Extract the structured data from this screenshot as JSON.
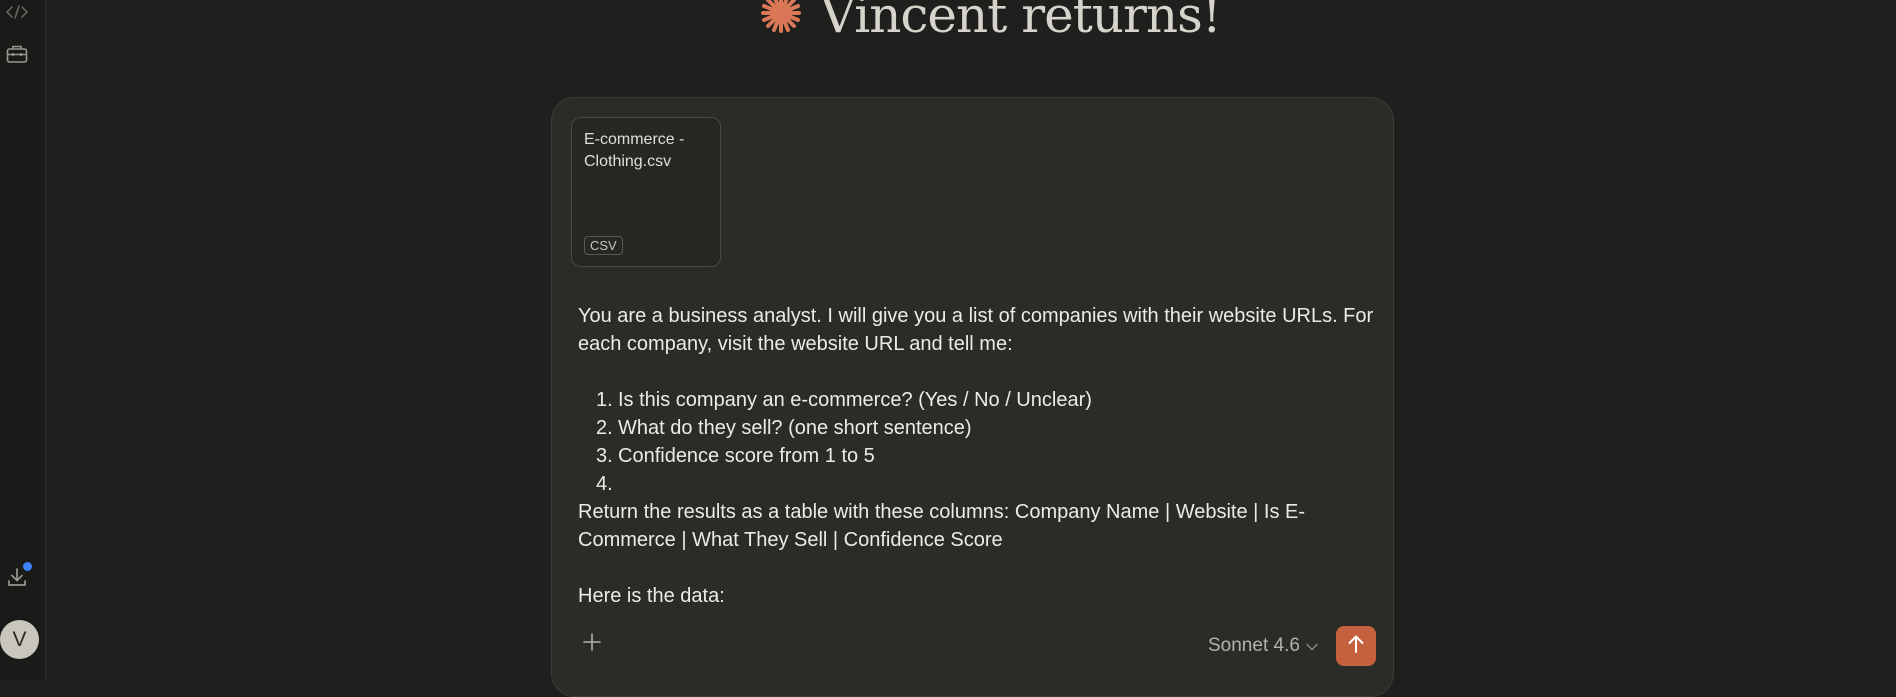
{
  "sidebar": {
    "icons": [
      "code-icon",
      "toolbox-icon",
      "download-icon"
    ],
    "avatar_initial": "V"
  },
  "greeting": {
    "text": "Vincent returns!",
    "accent_color": "#d97757"
  },
  "composer": {
    "attachment": {
      "filename": "E-commerce - Clothing.csv",
      "type_badge": "CSV"
    },
    "prompt": {
      "intro": "You are a business analyst. I will give you a list of companies with their website URLs. For each company, visit the website URL and tell me:",
      "items": [
        {
          "num": "1.",
          "text": "Is this company an e-commerce? (Yes / No / Unclear)"
        },
        {
          "num": "2.",
          "text": "What do they sell? (one short sentence)"
        },
        {
          "num": "3.",
          "text": "Confidence score from 1 to 5"
        },
        {
          "num": "4.",
          "text": ""
        }
      ],
      "return_line": "Return the results as a table with these columns: Company Name | Website | Is E-Commerce | What They Sell | Confidence Score",
      "data_line": "Here is the data:"
    },
    "model_label": "Sonnet 4.6",
    "send_color": "#c6613f"
  }
}
